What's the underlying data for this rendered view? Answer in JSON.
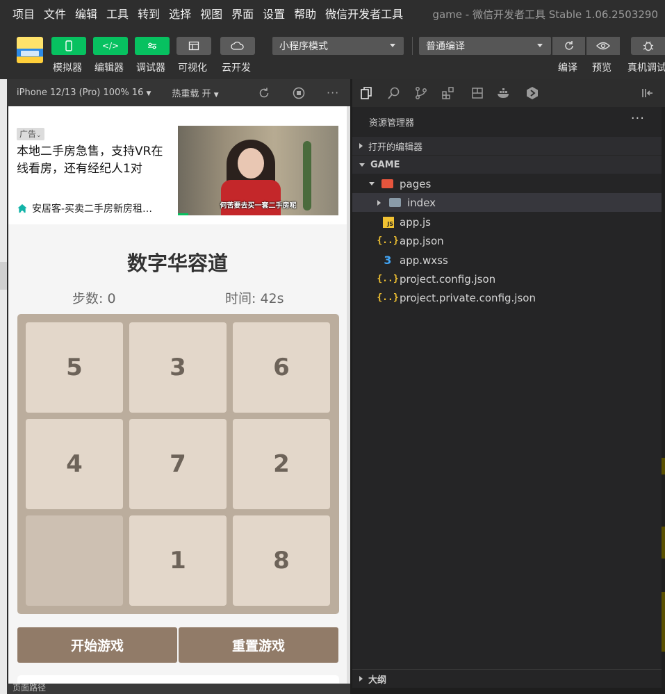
{
  "menu": [
    "项目",
    "文件",
    "编辑",
    "工具",
    "转到",
    "选择",
    "视图",
    "界面",
    "设置",
    "帮助",
    "微信开发者工具"
  ],
  "window_title": "game - 微信开发者工具 Stable 1.06.2503290",
  "toolbar": {
    "buttons": [
      {
        "label": "模拟器",
        "icon": "phone-icon"
      },
      {
        "label": "编辑器",
        "icon": "code-icon"
      },
      {
        "label": "调试器",
        "icon": "debug-toggle-icon"
      },
      {
        "label": "可视化",
        "icon": "layout-icon"
      },
      {
        "label": "云开发",
        "icon": "cloud-icon"
      }
    ],
    "mode_select": "小程序模式",
    "compile_select": "普通编译",
    "right_labels": [
      "编译",
      "预览",
      "真机调试"
    ]
  },
  "simulator": {
    "device": "iPhone 12/13 (Pro) 100% 16",
    "hot_reload": "热重载 开",
    "status_path": "页面路径"
  },
  "ad": {
    "tag": "广告",
    "text": "本地二手房急售，支持VR在线看房，还有经纪人1对",
    "source": "安居客-买卖二手房新房租…",
    "caption": "何苦要去买一套二手房呢"
  },
  "game": {
    "title": "数字华容道",
    "steps": "步数: 0",
    "time": "时间: 42s",
    "tiles": [
      "5",
      "3",
      "6",
      "4",
      "7",
      "2",
      "",
      "1",
      "8"
    ],
    "start_button": "开始游戏",
    "reset_button": "重置游戏"
  },
  "explorer": {
    "header": "资源管理器",
    "more": "···",
    "open_editors": "打开的编辑器",
    "project": "GAME",
    "tree": [
      {
        "name": "pages",
        "type": "folder-open"
      },
      {
        "name": "index",
        "type": "folder"
      },
      {
        "name": "app.js",
        "type": "js"
      },
      {
        "name": "app.json",
        "type": "json"
      },
      {
        "name": "app.wxss",
        "type": "css"
      },
      {
        "name": "project.config.json",
        "type": "json"
      },
      {
        "name": "project.private.config.json",
        "type": "json"
      }
    ],
    "outline": "大纲"
  }
}
